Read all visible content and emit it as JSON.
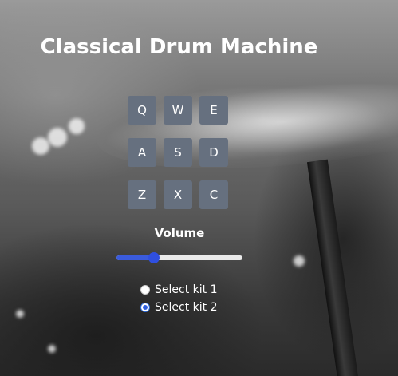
{
  "app": {
    "title": "Classical Drum Machine"
  },
  "pads": [
    {
      "key": "Q"
    },
    {
      "key": "W"
    },
    {
      "key": "E"
    },
    {
      "key": "A"
    },
    {
      "key": "S"
    },
    {
      "key": "D"
    },
    {
      "key": "Z"
    },
    {
      "key": "X"
    },
    {
      "key": "C"
    }
  ],
  "volume": {
    "label": "Volume",
    "value": 0.3
  },
  "kits": [
    {
      "label": "Select kit 1",
      "checked": false
    },
    {
      "label": "Select kit 2",
      "checked": true
    }
  ],
  "colors": {
    "pad": "#66707f",
    "accent": "#2f4fe0",
    "text": "#ffffff"
  }
}
